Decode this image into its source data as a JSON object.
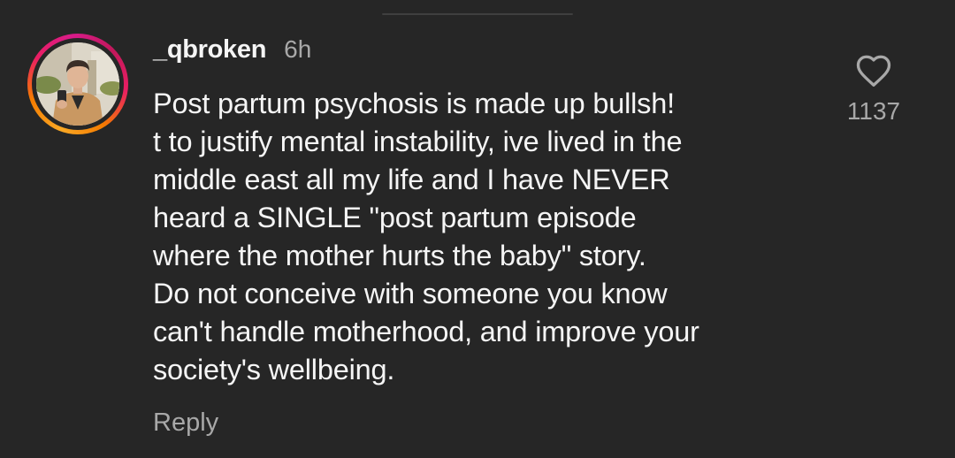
{
  "comment": {
    "username": "_qbroken",
    "time_ago": "6h",
    "text": "Post partum psychosis is made up bullsh!\nt to justify mental instability, ive lived in the\nmiddle east all my life and I have NEVER\nheard a SINGLE \"post partum episode\nwhere the mother hurts the baby\" story.\nDo not conceive with someone you know\ncan't handle motherhood, and improve your\nsociety's wellbeing.",
    "reply_label": "Reply",
    "like_count": "1137",
    "like_icon": "heart-outline-icon"
  },
  "colors": {
    "background": "#262626",
    "primary_text": "#f5f5f5",
    "secondary_text": "#a8a8a8",
    "story_ring_start": "#f9a825",
    "story_ring_end": "#d81b8a"
  }
}
